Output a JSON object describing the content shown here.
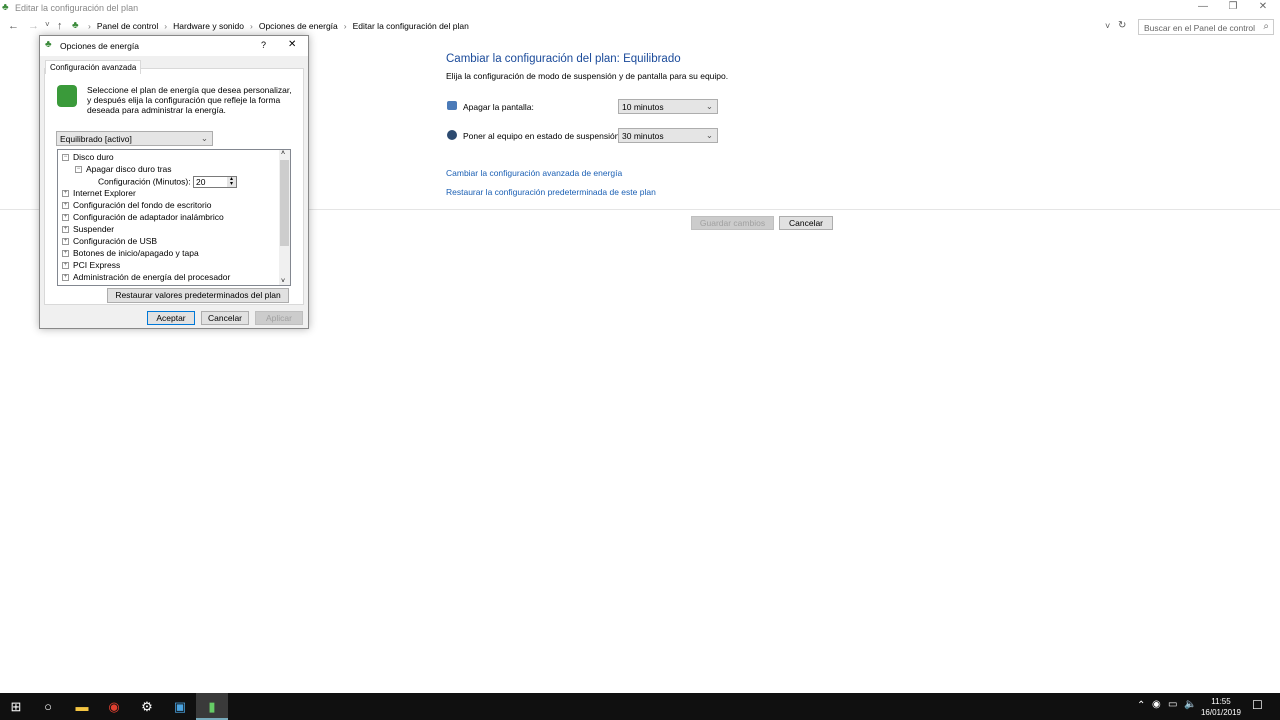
{
  "window": {
    "title": "Editar la configuración del plan",
    "minimize": "—",
    "maximize": "❐",
    "close": "✕"
  },
  "address": {
    "back": "←",
    "forward": "→",
    "recent": "˅",
    "up": "↑",
    "breadcrumbs": [
      "Panel de control",
      "Hardware y sonido",
      "Opciones de energía",
      "Editar la configuración del plan"
    ],
    "separator": "›",
    "dropdown": "˅",
    "refresh": "↻",
    "search_placeholder": "Buscar en el Panel de control",
    "search_icon": "⌕"
  },
  "main": {
    "heading": "Cambiar la configuración del plan: Equilibrado",
    "subtitle": "Elija la configuración de modo de suspensión y de pantalla para su equipo.",
    "display_label": "Apagar la pantalla:",
    "display_value": "10 minutos",
    "sleep_label": "Poner al equipo en estado de suspensión:",
    "sleep_value": "30 minutos",
    "link_advanced": "Cambiar la configuración avanzada de energía",
    "link_restore": "Restaurar la configuración predeterminada de este plan",
    "save": "Guardar cambios",
    "cancel": "Cancelar"
  },
  "dialog": {
    "title": "Opciones de energía",
    "help": "?",
    "close": "✕",
    "tab": "Configuración avanzada",
    "description": "Seleccione el plan de energía que desea personalizar, y después elija la configuración que refleje la forma deseada para administrar la energía.",
    "plan": "Equilibrado [activo]",
    "tree": {
      "disk": "Disco duro",
      "disk_off": "Apagar disco duro tras",
      "setting_label": "Configuración (Minutos):",
      "setting_value": "20",
      "items": [
        "Internet Explorer",
        "Configuración del fondo de escritorio",
        "Configuración de adaptador inalámbrico",
        "Suspender",
        "Configuración de USB",
        "Botones de inicio/apagado y tapa",
        "PCI Express",
        "Administración de energía del procesador"
      ]
    },
    "restore": "Restaurar valores predeterminados del plan",
    "ok": "Aceptar",
    "cancel": "Cancelar",
    "apply": "Aplicar"
  },
  "taskbar": {
    "time": "11:55",
    "date": "16/01/2019"
  }
}
